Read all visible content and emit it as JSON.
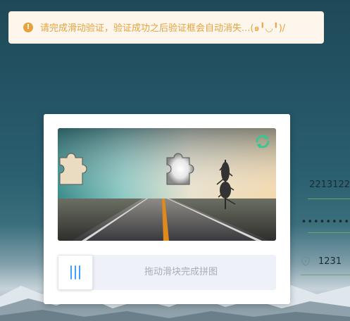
{
  "toast": {
    "icon": "warning-icon",
    "message": "请完成滑动验证，验证成功之后验证框会自动消失...(๑╹◡╹)/",
    "color": "#e6a23c"
  },
  "login_form": {
    "username_value": "2213122",
    "password_value": "••••••••",
    "code_value": "1231"
  },
  "captcha": {
    "refresh_icon": "refresh-icon",
    "slider_hint": "拖动滑块完成拼图",
    "grip_icon": "slider-grip-icon",
    "accent": "#409eff"
  }
}
